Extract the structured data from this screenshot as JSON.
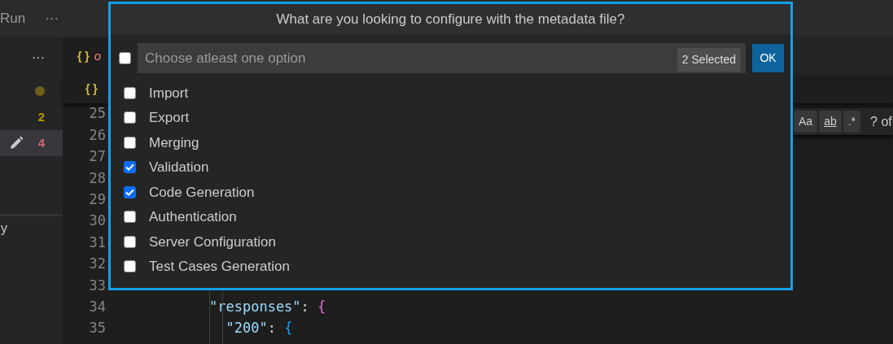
{
  "top_bar": {
    "menu": "Run",
    "more": "···"
  },
  "sidebar": {
    "more": "···",
    "items": [
      {
        "kind": "dot",
        "color": "#6e5f1c",
        "selected": false
      },
      {
        "kind": "count",
        "text": "2",
        "color": "#b89500",
        "selected": false
      },
      {
        "kind": "edited",
        "text": "4",
        "color": "#d16969",
        "selected": true
      }
    ],
    "section_fragment": "y"
  },
  "editor": {
    "tab": {
      "icon": "{ }",
      "label": "o"
    },
    "breadcrumb": {
      "icon": "{ }"
    },
    "find_widget": {
      "options": [
        "Aa",
        "ab",
        ".*"
      ],
      "result": "? of"
    },
    "lines": [
      {
        "number": "25"
      },
      {
        "number": "26"
      },
      {
        "number": "27"
      },
      {
        "number": "28"
      },
      {
        "number": "29"
      },
      {
        "number": "30"
      },
      {
        "number": "31"
      },
      {
        "number": "32"
      },
      {
        "number": "33"
      },
      {
        "number": "34",
        "code": [
          {
            "kind": "key",
            "text": "\"responses\""
          },
          {
            "kind": "punct",
            "text": ": "
          },
          {
            "kind": "brace2",
            "text": "{"
          }
        ]
      },
      {
        "number": "35",
        "code": [
          {
            "kind": "key",
            "text": "  \"200\""
          },
          {
            "kind": "punct",
            "text": ": "
          },
          {
            "kind": "brace3",
            "text": "{"
          }
        ]
      }
    ]
  },
  "dialog": {
    "title": "What are you looking to configure with the metadata file?",
    "select_all": {
      "checked": false
    },
    "search": {
      "placeholder": "Choose atleast one option"
    },
    "badge": "2 Selected",
    "ok": "OK",
    "options": [
      {
        "label": "Import",
        "checked": false
      },
      {
        "label": "Export",
        "checked": false
      },
      {
        "label": "Merging",
        "checked": false
      },
      {
        "label": "Validation",
        "checked": true
      },
      {
        "label": "Code Generation",
        "checked": true
      },
      {
        "label": "Authentication",
        "checked": false
      },
      {
        "label": "Server Configuration",
        "checked": false
      },
      {
        "label": "Test Cases Generation",
        "checked": false
      }
    ]
  }
}
